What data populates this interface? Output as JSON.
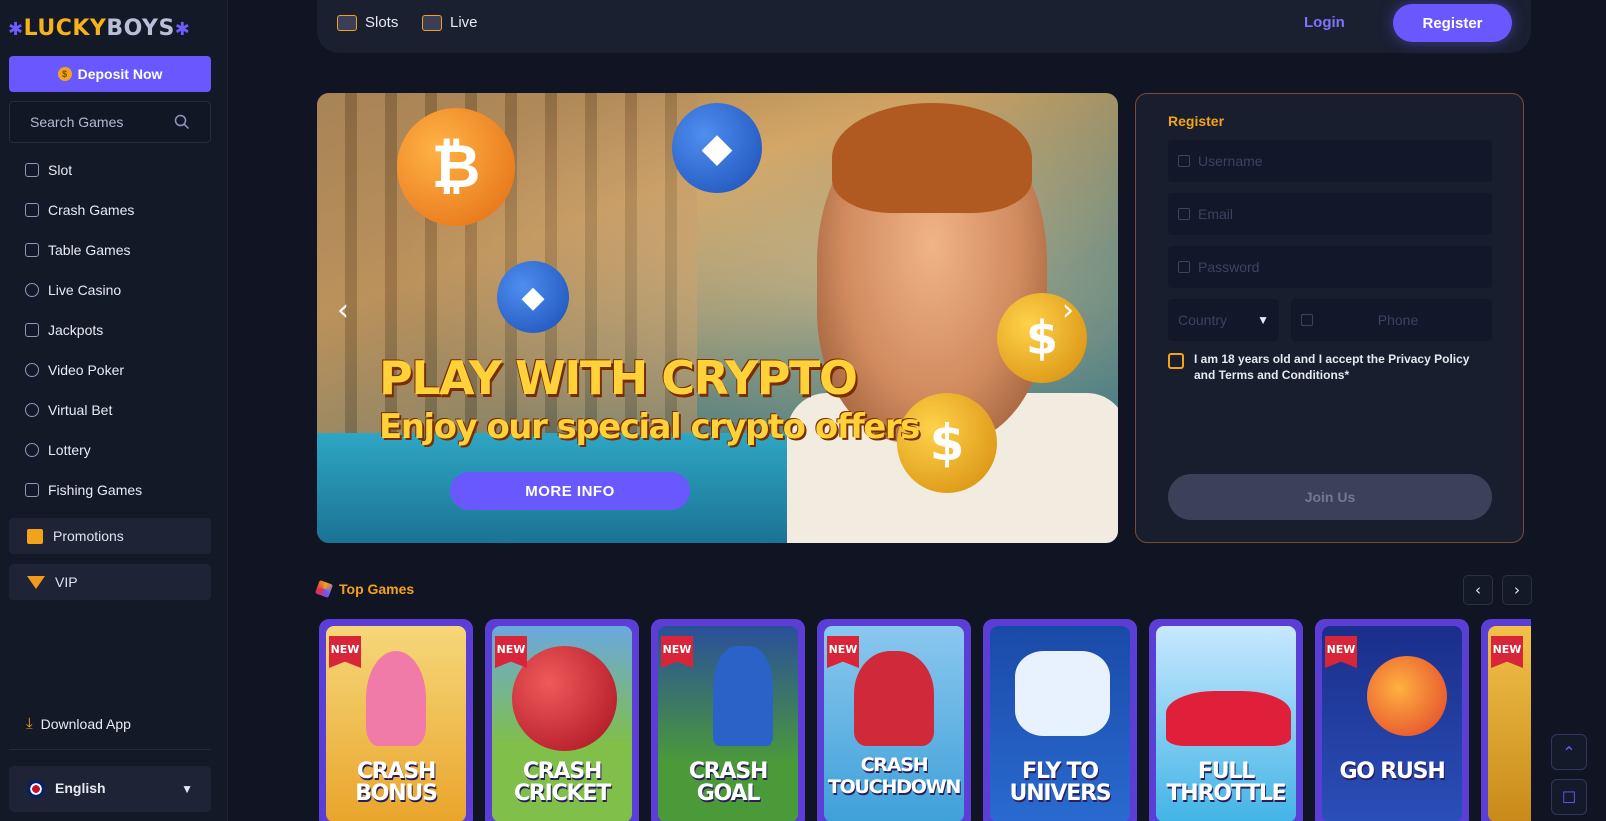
{
  "brand": {
    "name_a": "LUCKY",
    "name_b": "BOYS"
  },
  "sidebar": {
    "deposit_label": "Deposit Now",
    "search_placeholder": "Search Games",
    "items": [
      {
        "label": "Slot",
        "icon": "slot-icon"
      },
      {
        "label": "Crash Games",
        "icon": "rocket-icon"
      },
      {
        "label": "Table Games",
        "icon": "table-icon"
      },
      {
        "label": "Live Casino",
        "icon": "live-icon"
      },
      {
        "label": "Jackpots",
        "icon": "trophy-icon"
      },
      {
        "label": "Video Poker",
        "icon": "poker-chip-icon"
      },
      {
        "label": "Virtual Bet",
        "icon": "ball-icon"
      },
      {
        "label": "Lottery",
        "icon": "lottery-icon"
      },
      {
        "label": "Fishing Games",
        "icon": "fish-icon"
      }
    ],
    "promotions_label": "Promotions",
    "vip_label": "VIP",
    "download_label": "Download App",
    "language_label": "English"
  },
  "topbar": {
    "tabs": [
      {
        "label": "Slots",
        "icon": "slot-machine-icon"
      },
      {
        "label": "Live",
        "icon": "cards-icon"
      }
    ],
    "login_label": "Login",
    "register_label": "Register"
  },
  "banner": {
    "headline": "PLAY WITH CRYPTO",
    "subline": "Enjoy our special crypto offers",
    "cta_label": "MORE INFO"
  },
  "register_form": {
    "title": "Register",
    "username_placeholder": "Username",
    "email_placeholder": "Email",
    "password_placeholder": "Password",
    "country_placeholder": "Country",
    "phone_placeholder": "Phone",
    "consent_text": "I am 18 years old and I accept the Privacy Policy and Terms and Conditions*",
    "submit_label": "Join Us"
  },
  "top_games": {
    "title": "Top Games",
    "badge": "NEW",
    "games": [
      {
        "name": "CRASH BONUS",
        "is_new": true,
        "bg": "#f2c14a"
      },
      {
        "name": "CRASH CRICKET",
        "is_new": true,
        "bg": "#7fbf4a"
      },
      {
        "name": "CRASH GOAL",
        "is_new": true,
        "bg": "#4a9a3a"
      },
      {
        "name": "CRASH TOUCHDOWN",
        "is_new": true,
        "bg": "#3fa0d8"
      },
      {
        "name": "FLY TO UNIVERS",
        "is_new": false,
        "bg": "#2a6ad0"
      },
      {
        "name": "FULL THROTTLE",
        "is_new": false,
        "bg": "#42b4e6"
      },
      {
        "name": "GO RUSH",
        "is_new": true,
        "bg": "#2a4fb8"
      }
    ]
  },
  "colors": {
    "accent": "#6a58ff",
    "gold": "#f3a31a",
    "background": "#111523"
  }
}
